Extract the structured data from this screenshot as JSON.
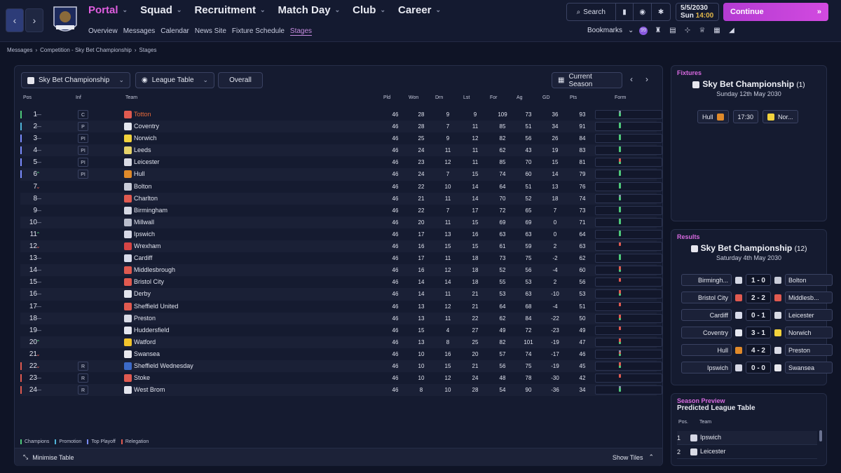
{
  "nav": {
    "menu": [
      "Portal",
      "Squad",
      "Recruitment",
      "Match Day",
      "Club",
      "Career"
    ],
    "active_menu": "Portal",
    "submenu": [
      "Overview",
      "Messages",
      "Calendar",
      "News Site",
      "Fixture Schedule",
      "Stages"
    ],
    "active_sub": "Stages"
  },
  "topbar": {
    "search": "Search",
    "date": "5/5/2030",
    "day": "Sun",
    "time": "14:00",
    "continue": "Continue",
    "bookmarks": "Bookmarks",
    "notif": "99"
  },
  "breadcrumb": [
    "Messages",
    "Competition - Sky Bet Championship",
    "Stages"
  ],
  "controls": {
    "competition": "Sky Bet Championship",
    "view": "League Table",
    "filter": "Overall",
    "season": "Current Season"
  },
  "table": {
    "headers": [
      "Pos",
      "Inf",
      "Team",
      "Pld",
      "Won",
      "Drn",
      "Lst",
      "For",
      "Ag",
      "GD",
      "Pts",
      "Form"
    ],
    "rows": [
      [
        "1",
        "C",
        "Totton",
        "46",
        "28",
        "9",
        "9",
        "109",
        "73",
        "36",
        "93",
        "none",
        "champ",
        "#e05a50",
        [
          1,
          1,
          1,
          1,
          0
        ]
      ],
      [
        "2",
        "P",
        "Coventry",
        "46",
        "28",
        "7",
        "11",
        "85",
        "51",
        "34",
        "91",
        "none",
        "promo",
        "#e5e7ef",
        [
          -1,
          0,
          1,
          0,
          1
        ]
      ],
      [
        "3",
        "PI",
        "Norwich",
        "46",
        "25",
        "9",
        "12",
        "82",
        "56",
        "26",
        "84",
        "none",
        "playoff",
        "#f2d23c",
        [
          -1,
          0,
          -1,
          1,
          1
        ]
      ],
      [
        "4",
        "PI",
        "Leeds",
        "46",
        "24",
        "11",
        "11",
        "62",
        "43",
        "19",
        "83",
        "none",
        "playoff",
        "#e6d36a",
        [
          1,
          -1,
          0,
          1,
          1
        ]
      ],
      [
        "5",
        "PI",
        "Leicester",
        "46",
        "23",
        "12",
        "11",
        "85",
        "70",
        "15",
        "81",
        "none",
        "playoff",
        "#d9dbe5",
        [
          1,
          -1,
          1,
          1,
          -1
        ]
      ],
      [
        "6",
        "PI",
        "Hull",
        "46",
        "24",
        "7",
        "15",
        "74",
        "60",
        "14",
        "79",
        "up",
        "playoff",
        "#e08a2a",
        [
          -1,
          1,
          -1,
          -1,
          1
        ]
      ],
      [
        "7",
        "",
        "Bolton",
        "46",
        "22",
        "10",
        "14",
        "64",
        "51",
        "13",
        "76",
        "dn",
        "",
        "#c9ccd8",
        [
          -1,
          0,
          -1,
          1,
          1
        ]
      ],
      [
        "8",
        "",
        "Charlton",
        "46",
        "21",
        "11",
        "14",
        "70",
        "52",
        "18",
        "74",
        "none",
        "",
        "#e05a50",
        [
          -1,
          1,
          -1,
          1,
          0
        ]
      ],
      [
        "9",
        "",
        "Birmingham",
        "46",
        "22",
        "7",
        "17",
        "72",
        "65",
        "7",
        "73",
        "none",
        "",
        "#d5d8e4",
        [
          1,
          0,
          0,
          -1,
          1
        ]
      ],
      [
        "10",
        "",
        "Millwall",
        "46",
        "20",
        "11",
        "15",
        "69",
        "69",
        "0",
        "71",
        "none",
        "",
        "#b9bdcc",
        [
          1,
          -1,
          1,
          -1,
          1
        ]
      ],
      [
        "11",
        "",
        "Ipswich",
        "46",
        "17",
        "13",
        "16",
        "63",
        "63",
        "0",
        "64",
        "up",
        "",
        "#d6d8e6",
        [
          0,
          0,
          0,
          1,
          1
        ]
      ],
      [
        "12",
        "",
        "Wrexham",
        "46",
        "16",
        "15",
        "15",
        "61",
        "59",
        "2",
        "63",
        "dn",
        "",
        "#d64545",
        [
          0,
          0,
          0,
          0,
          -1
        ]
      ],
      [
        "13",
        "",
        "Cardiff",
        "46",
        "17",
        "11",
        "18",
        "73",
        "75",
        "-2",
        "62",
        "none",
        "",
        "#d8dbea",
        [
          1,
          1,
          1,
          1,
          1
        ]
      ],
      [
        "14",
        "",
        "Middlesbrough",
        "46",
        "16",
        "12",
        "18",
        "52",
        "56",
        "-4",
        "60",
        "none",
        "",
        "#e05a50",
        [
          -1,
          0,
          -1,
          1,
          -1
        ]
      ],
      [
        "15",
        "",
        "Bristol City",
        "46",
        "14",
        "14",
        "18",
        "55",
        "53",
        "2",
        "56",
        "none",
        "",
        "#e05a50",
        [
          -1,
          -1,
          0,
          -1,
          -1
        ]
      ],
      [
        "16",
        "",
        "Derby",
        "46",
        "14",
        "11",
        "21",
        "53",
        "63",
        "-10",
        "53",
        "none",
        "",
        "#e3e5ee",
        [
          1,
          0,
          -1,
          -1,
          -1
        ]
      ],
      [
        "17",
        "",
        "Sheffield United",
        "46",
        "13",
        "12",
        "21",
        "64",
        "68",
        "-4",
        "51",
        "none",
        "",
        "#e05a50",
        [
          0,
          -1,
          -1,
          -1,
          -1
        ]
      ],
      [
        "18",
        "",
        "Preston",
        "46",
        "13",
        "11",
        "22",
        "62",
        "84",
        "-22",
        "50",
        "none",
        "",
        "#d9dbe6",
        [
          1,
          -1,
          0,
          -1,
          -1
        ]
      ],
      [
        "19",
        "",
        "Huddersfield",
        "46",
        "15",
        "4",
        "27",
        "49",
        "72",
        "-23",
        "49",
        "none",
        "",
        "#e3e5ee",
        [
          -1,
          0,
          0,
          -1,
          -1
        ]
      ],
      [
        "20",
        "",
        "Watford",
        "46",
        "13",
        "8",
        "25",
        "82",
        "101",
        "-19",
        "47",
        "up",
        "",
        "#f2c42c",
        [
          1,
          -1,
          -1,
          -1,
          -1
        ]
      ],
      [
        "21",
        "",
        "Swansea",
        "46",
        "10",
        "16",
        "20",
        "57",
        "74",
        "-17",
        "46",
        "dn",
        "",
        "#e8e8ee",
        [
          1,
          -1,
          0,
          -1,
          0
        ]
      ],
      [
        "22",
        "R",
        "Sheffield Wednesday",
        "46",
        "10",
        "15",
        "21",
        "56",
        "75",
        "-19",
        "45",
        "dn",
        "releg",
        "#3c6ac8",
        [
          1,
          -1,
          1,
          1,
          -1
        ]
      ],
      [
        "23",
        "R",
        "Stoke",
        "46",
        "10",
        "12",
        "24",
        "48",
        "78",
        "-30",
        "42",
        "none",
        "releg",
        "#e05a50",
        [
          -1,
          -1,
          -1,
          0,
          -1
        ]
      ],
      [
        "24",
        "R",
        "West Brom",
        "46",
        "8",
        "10",
        "28",
        "54",
        "90",
        "-36",
        "34",
        "none",
        "releg",
        "#e3e5ee",
        [
          1,
          -1,
          1,
          1,
          0
        ]
      ]
    ]
  },
  "legend": [
    "Champions",
    "Promotion",
    "Top Playoff",
    "Relegation"
  ],
  "bottom": {
    "minimise": "Minimise Table",
    "tiles": "Show Tiles"
  },
  "fixtures": {
    "title": "Fixtures",
    "comp": "Sky Bet Championship",
    "count": "(1)",
    "date": "Sunday 12th May 2030",
    "home": "Hull",
    "time": "17:30",
    "away": "Nor..."
  },
  "results": {
    "title": "Results",
    "comp": "Sky Bet Championship",
    "count": "(12)",
    "date": "Saturday 4th May 2030",
    "games": [
      [
        "Birmingh...",
        "1 - 0",
        "Bolton"
      ],
      [
        "Bristol City",
        "2 - 2",
        "Middlesb..."
      ],
      [
        "Cardiff",
        "0 - 1",
        "Leicester"
      ],
      [
        "Coventry",
        "3 - 1",
        "Norwich"
      ],
      [
        "Hull",
        "4 - 2",
        "Preston"
      ],
      [
        "Ipswich",
        "0 - 0",
        "Swansea"
      ]
    ]
  },
  "preview": {
    "title": "Season Preview",
    "subtitle": "Predicted League Table",
    "headers": [
      "Pos.",
      "Team"
    ],
    "rows": [
      [
        "1",
        "Ipswich"
      ],
      [
        "2",
        "Leicester"
      ]
    ]
  },
  "colors": {
    "accent": "#d24ae0",
    "win": "#4ec97a",
    "loss": "#e05a50",
    "draw": "#8890aa"
  }
}
